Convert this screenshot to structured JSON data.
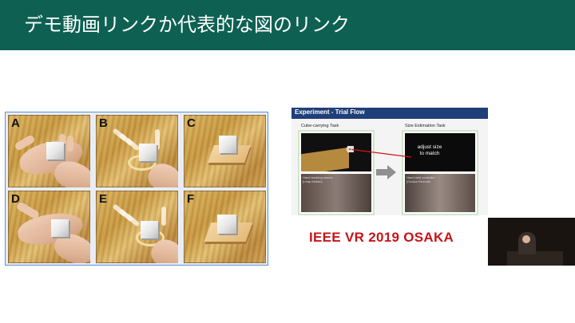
{
  "header": {
    "title": "デモ動画リンクか代表的な図のリンク",
    "background": "#0e6152"
  },
  "figure": {
    "panels": [
      {
        "letter": "A"
      },
      {
        "letter": "B"
      },
      {
        "letter": "C"
      },
      {
        "letter": "D"
      },
      {
        "letter": "E"
      },
      {
        "letter": "F"
      }
    ]
  },
  "video": {
    "slide_title": "Experiment - Trial Flow",
    "left_task": "Cube-carrying Task",
    "right_task": "Size Estimation Task",
    "caption_1": "Hand tracking sensor",
    "caption_1b": "(Leap Motion)",
    "caption_2": "Hand held controller",
    "caption_2b": "(Oculus Remote)",
    "adjust_line1": "adjust size",
    "adjust_line2": "to match",
    "conference": "IEEE VR 2019 OSAKA"
  }
}
